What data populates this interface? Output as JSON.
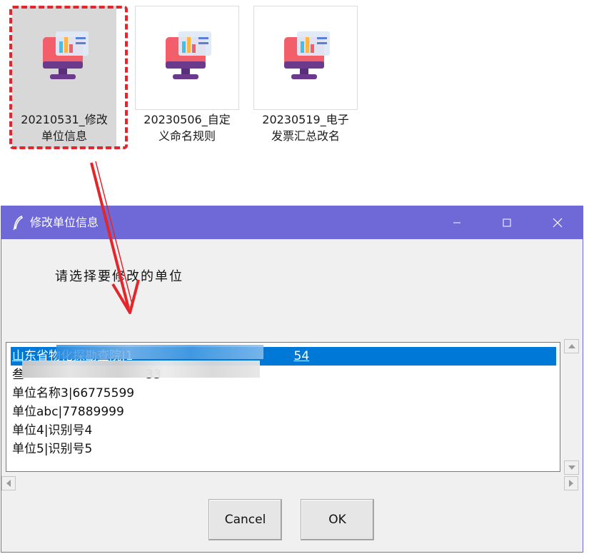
{
  "desktop": {
    "files": [
      {
        "line1": "20210531_修改",
        "line2": "单位信息",
        "selected": true
      },
      {
        "line1": "20230506_自定",
        "line2": "义命名规则",
        "selected": false
      },
      {
        "line1": "20230519_电子",
        "line2": "发票汇总改名",
        "selected": false
      }
    ]
  },
  "dialog": {
    "title": "修改单位信息",
    "prompt": "请选择要修改的单位",
    "list_items": [
      "山东省物化探勘查院|1",
      "叁",
      "单位名称3|66775599",
      "单位abc|77889999",
      "单位4|识别号4",
      "单位5|识别号5"
    ],
    "list_item_suffixes": [
      "54",
      "33",
      "",
      "",
      "",
      ""
    ],
    "cancel_label": "Cancel",
    "ok_label": "OK"
  },
  "colors": {
    "titlebar": "#6f69d8",
    "selection": "#0078d7",
    "annotation_red": "#e3262b"
  }
}
